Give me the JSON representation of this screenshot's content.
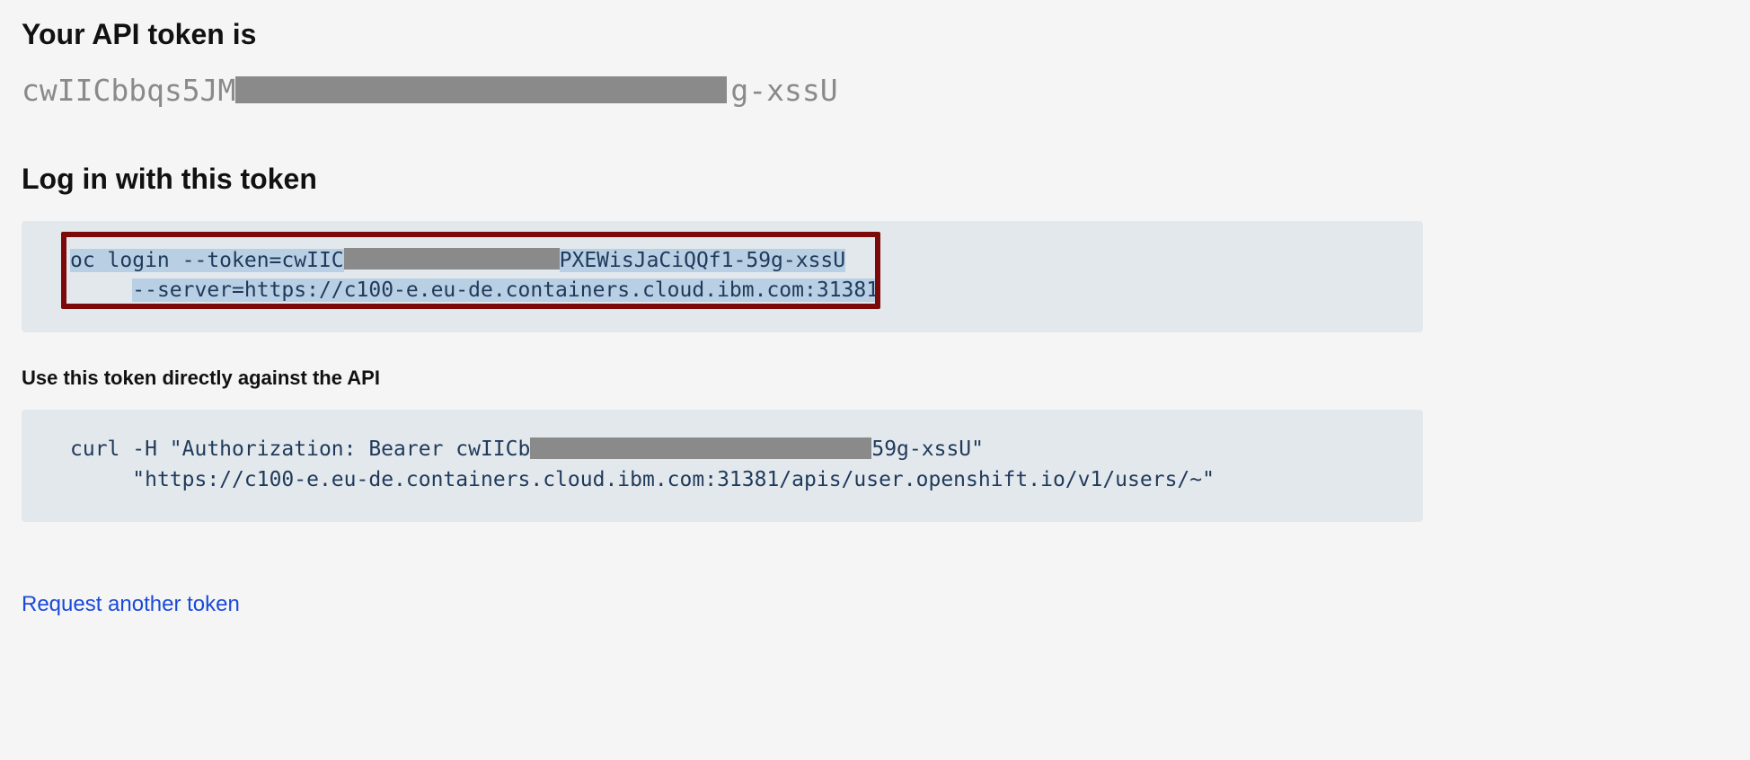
{
  "headings": {
    "api_token": "Your API token is",
    "login_with_token": "Log in with this token",
    "use_directly": "Use this token directly against the API"
  },
  "token": {
    "prefix": "cwIICbbqs5JM",
    "suffix_raw": "g-xssU"
  },
  "login_cmd": {
    "line1_pre": "oc login --token=cwIIC",
    "line1_post": "PXEWisJaCiQQf1-59g-xssU",
    "line2_indent": "     ",
    "line2_text": "--server=https://c100-e.eu-de.containers.cloud.ibm.com:31381"
  },
  "curl_cmd": {
    "line1_pre": "curl -H \"Authorization: Bearer cwIICb",
    "line1_post": "59g-xssU\"",
    "line2_indent": "     ",
    "line2_text": "\"https://c100-e.eu-de.containers.cloud.ibm.com:31381/apis/user.openshift.io/v1/users/~\""
  },
  "links": {
    "request_another": "Request another token"
  }
}
